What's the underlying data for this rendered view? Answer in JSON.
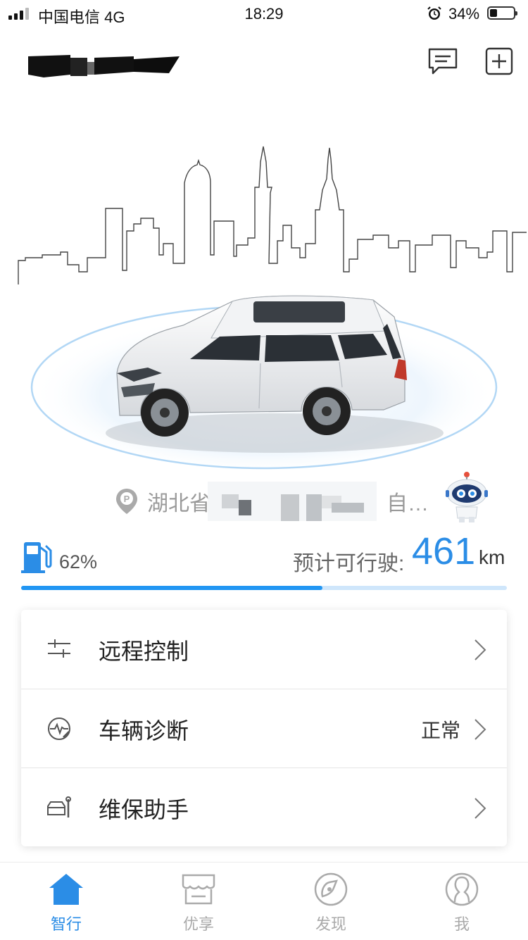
{
  "status_bar": {
    "carrier": "中国电信 4G",
    "time": "18:29",
    "battery": "34%"
  },
  "header": {
    "message_icon": "message-icon",
    "add_icon": "plus-icon"
  },
  "location": {
    "icon": "parking-pin-icon",
    "text_prefix": "湖北省",
    "text_suffix": "自…"
  },
  "fuel": {
    "icon": "fuel-pump-icon",
    "percent_label": "62%",
    "level": 0.62,
    "range_label": "预计可行驶:",
    "range_value": "461",
    "range_unit": "km"
  },
  "menu": [
    {
      "label": "远程控制",
      "status": "",
      "icon": "sliders-icon"
    },
    {
      "label": "车辆诊断",
      "status": "正常",
      "icon": "diagnosis-icon"
    },
    {
      "label": "维保助手",
      "status": "",
      "icon": "maintenance-icon"
    }
  ],
  "tabs": [
    {
      "label": "智行",
      "icon": "home-icon",
      "active": true
    },
    {
      "label": "优享",
      "icon": "store-icon",
      "active": false
    },
    {
      "label": "发现",
      "icon": "compass-icon",
      "active": false
    },
    {
      "label": "我",
      "icon": "user-icon",
      "active": false
    }
  ],
  "colors": {
    "accent": "#2b8de6",
    "progress": "#2196f3",
    "progress_track": "#cfe6fb"
  }
}
